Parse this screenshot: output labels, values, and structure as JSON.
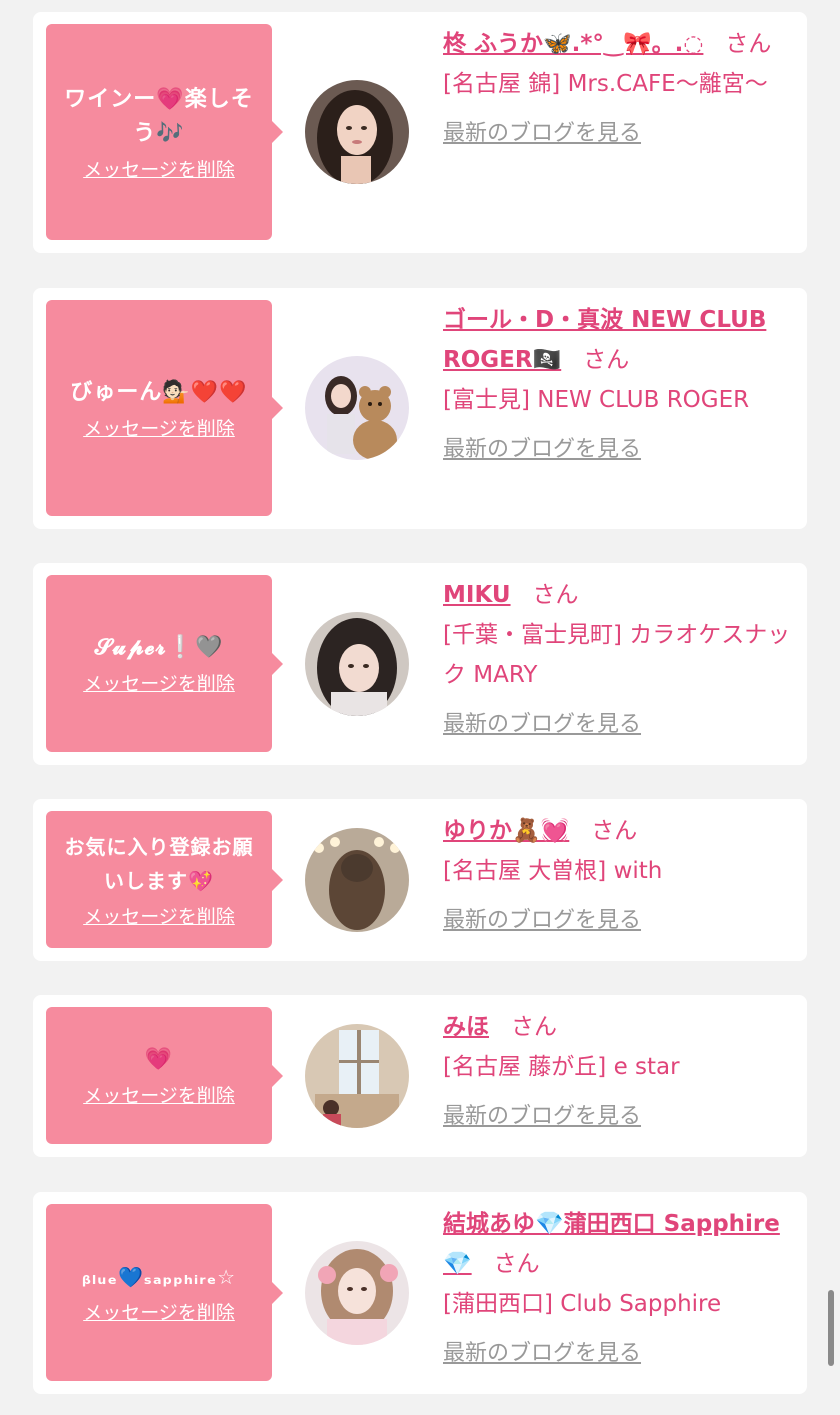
{
  "colors": {
    "bubble": "#f68b9e",
    "name": "#e0457a",
    "blog": "#999999",
    "card": "#ffffff",
    "page": "#f2f2f2"
  },
  "items": [
    {
      "message": "ワインー💗楽しそう🎶",
      "delete_label": "メッセージを削除",
      "name": "柊 ふうか🦋.*°‿🎀。.◌",
      "honorific": "さん",
      "shop": "[名古屋 錦] Mrs.CAFE〜離宮〜",
      "blog_label": "最新のブログを見る",
      "avatar_icon": "woman-portrait-icon"
    },
    {
      "message": "びゅーん💁🏻❤️❤️",
      "delete_label": "メッセージを削除",
      "name": "ゴール・D・真波 NEW CLUB ROGER🏴‍☠️",
      "honorific": "さん",
      "shop": "[富士見] NEW CLUB ROGER",
      "blog_label": "最新のブログを見る",
      "avatar_icon": "woman-with-teddy-bear-icon"
    },
    {
      "message": "𝓢𝓾𝓹𝓮𝓻❕🩶",
      "delete_label": "メッセージを削除",
      "name": "MIKU",
      "honorific": "さん",
      "shop": "[千葉・富士見町] カラオケスナック MARY",
      "blog_label": "最新のブログを見る",
      "avatar_icon": "woman-portrait-icon"
    },
    {
      "message": "お気に入り登録お願いします💖",
      "delete_label": "メッセージを削除",
      "name": "ゆりか🧸💓",
      "honorific": "さん",
      "shop": "[名古屋 大曽根] with",
      "blog_label": "最新のブログを見る",
      "avatar_icon": "hair-back-view-icon"
    },
    {
      "message": "💗",
      "delete_label": "メッセージを削除",
      "name": "みほ",
      "honorific": "さん",
      "shop": "[名古屋 藤が丘] e star",
      "blog_label": "最新のブログを見る",
      "avatar_icon": "room-window-icon"
    },
    {
      "message": "ᵦₗᵤₑ💙ₛₐₚₚₕᵢᵣₑ☆",
      "delete_label": "メッセージを削除",
      "name": "結城あゆ💎蒲田西口 Sapphire💎",
      "honorific": "さん",
      "shop": "[蒲田西口] Club Sapphire",
      "blog_label": "最新のブログを見る",
      "avatar_icon": "woman-kimono-icon"
    }
  ]
}
